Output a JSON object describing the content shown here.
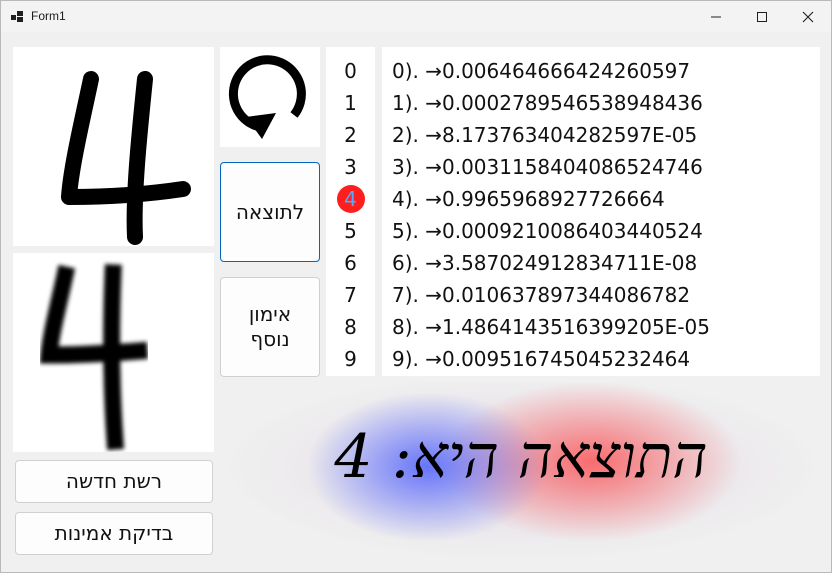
{
  "window": {
    "title": "Form1"
  },
  "buttons": {
    "result": "לתוצאה",
    "extra_training_line1": "אימון",
    "extra_training_line2": "נוסף",
    "new_network": "רשת חדשה",
    "accuracy_test": "בדיקת אמינות"
  },
  "digits": [
    "0",
    "1",
    "2",
    "3",
    "4",
    "5",
    "6",
    "7",
    "8",
    "9"
  ],
  "highlighted_digit": "4",
  "colors": {
    "highlight": "#ff1e1e",
    "highlight_text": "#58a8ff",
    "focus_border": "#0067c0"
  },
  "results": [
    "0). →0.006464666424260597",
    "1). →0.0002789546538948436",
    "2). →8.173763404282597E-05",
    "3). →0.003115840408652474​6",
    "4). →0.9965968927726664",
    "5). →0.0009210086403440524",
    "6). →3.58702491283471​1E-08",
    "7). →0.010637897344086782",
    "8). →1.4864143516399205E-05",
    "9). →0.009516745045232464"
  ],
  "verdict": "התוצאה היא: 4",
  "icons": {
    "refresh": "refresh-icon"
  }
}
